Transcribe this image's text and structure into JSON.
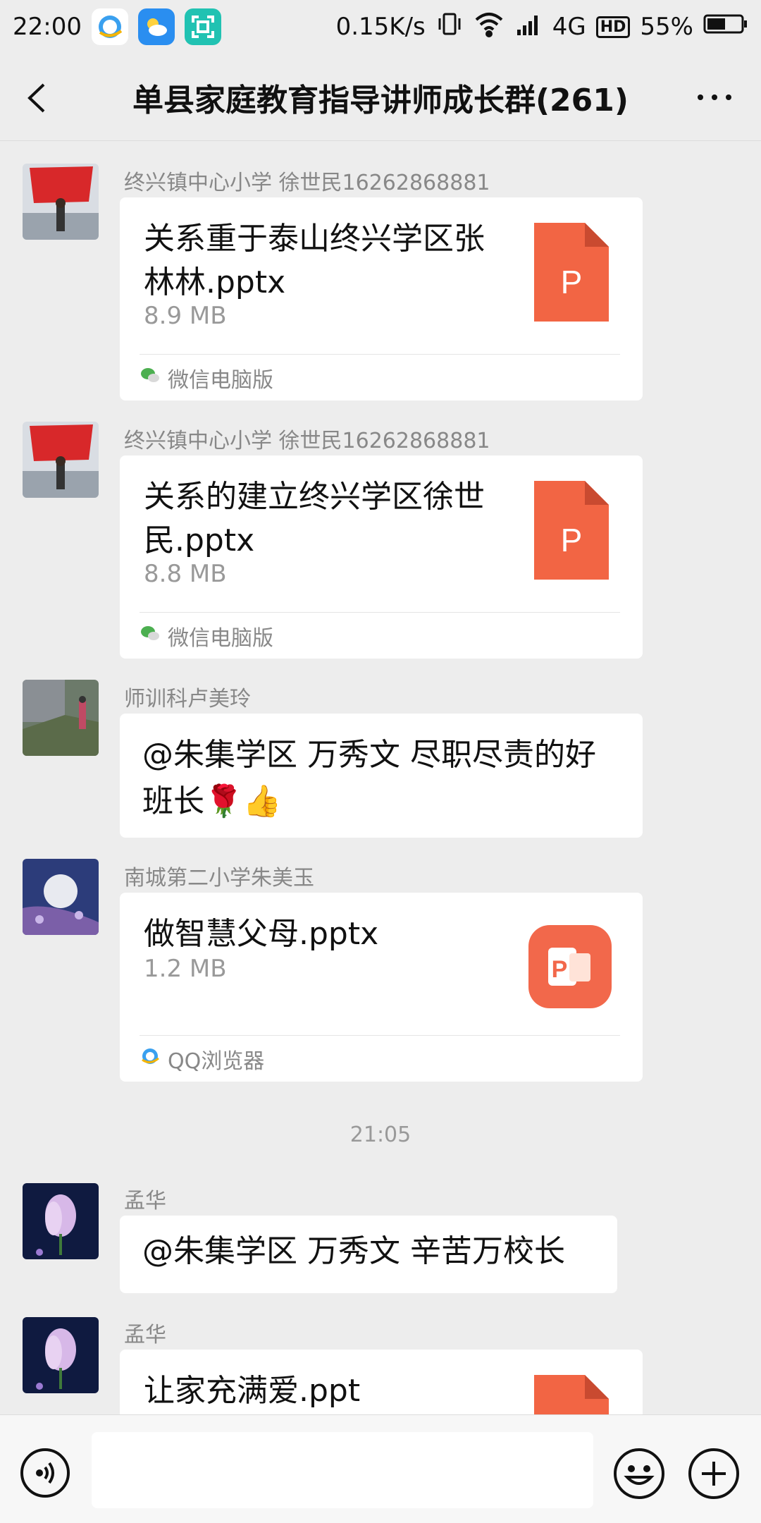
{
  "status_bar": {
    "time": "22:00",
    "net_speed": "0.15K/s",
    "network": "4G",
    "hd": "HD",
    "battery": "55%",
    "battery_level": 0.55
  },
  "header": {
    "title": "单县家庭教育指导讲师成长群(261)"
  },
  "messages": [
    {
      "sender": "终兴镇中心小学 徐世民16262868881",
      "file_name": "关系重于泰山终兴学区张林林.pptx",
      "file_size": "8.9 MB",
      "source": "微信电脑版"
    },
    {
      "sender": "终兴镇中心小学 徐世民16262868881",
      "file_name": "关系的建立终兴学区徐世民.pptx",
      "file_size": "8.8 MB",
      "source": "微信电脑版"
    },
    {
      "sender": "师训科卢美玲",
      "text": "@朱集学区  万秀文  尽职尽责的好班长🌹👍"
    },
    {
      "sender": "南城第二小学朱美玉",
      "file_name": "做智慧父母.pptx",
      "file_size": "1.2 MB",
      "source": "QQ浏览器"
    },
    {
      "sender": "孟华",
      "text": "@朱集学区  万秀文  辛苦万校长"
    },
    {
      "sender": "孟华",
      "file_name": "让家充满爱.ppt"
    }
  ],
  "timestamp": "21:05",
  "file_icon_letter": "P",
  "colors": {
    "ppt_orange": "#f26544",
    "background": "#ededed",
    "bubble": "#ffffff"
  }
}
